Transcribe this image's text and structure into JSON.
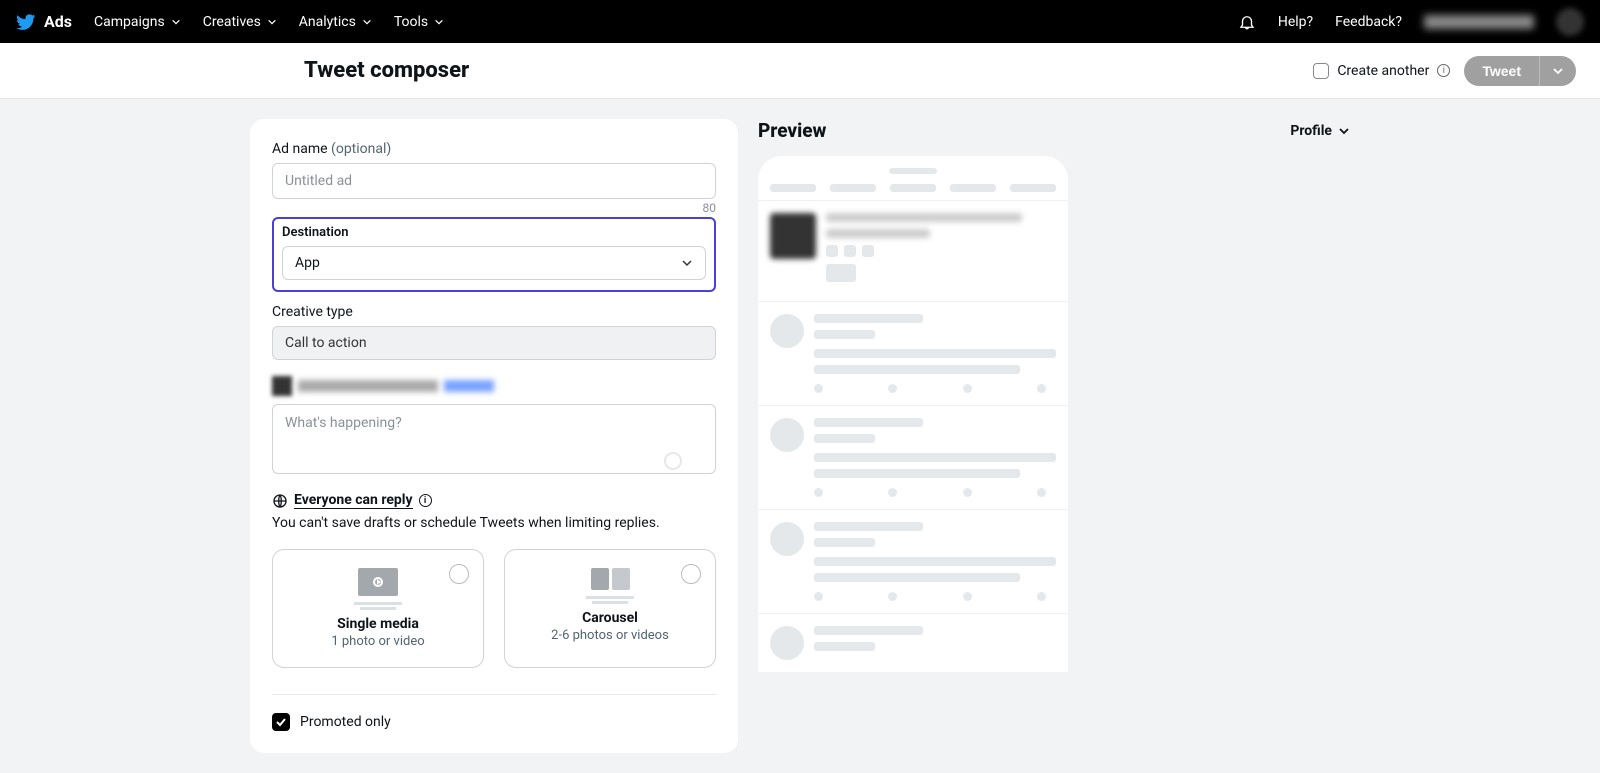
{
  "brand": "Ads",
  "nav": {
    "campaigns": "Campaigns",
    "creatives": "Creatives",
    "analytics": "Analytics",
    "tools": "Tools"
  },
  "nav_right": {
    "help": "Help?",
    "feedback": "Feedback?"
  },
  "page_title": "Tweet composer",
  "create_another": "Create another",
  "tweet_button": "Tweet",
  "form": {
    "ad_name_label": "Ad name",
    "ad_name_optional": "(optional)",
    "ad_name_placeholder": "Untitled ad",
    "ad_name_count": "80",
    "destination_label": "Destination",
    "destination_value": "App",
    "creative_type_label": "Creative type",
    "creative_type_value": "Call to action",
    "tweet_placeholder": "What's happening?",
    "reply_label": "Everyone can reply",
    "reply_help": "You can't save drafts or schedule Tweets when limiting replies.",
    "media": {
      "single_title": "Single media",
      "single_sub": "1 photo or video",
      "carousel_title": "Carousel",
      "carousel_sub": "2-6 photos or videos"
    },
    "promoted_only": "Promoted only"
  },
  "preview": {
    "title": "Preview",
    "selector": "Profile"
  }
}
